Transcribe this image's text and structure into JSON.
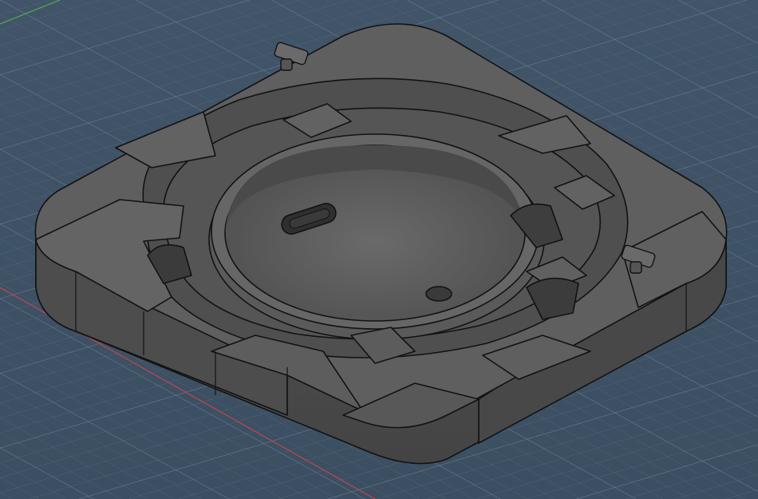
{
  "viewport": {
    "background_color": "#3f5265",
    "grid_minor_color": "#56697c",
    "grid_major_color": "#6c8094",
    "x_axis_color": "#c0464d",
    "y_axis_color": "#4fb055"
  },
  "model": {
    "body_color": "#5a5a5a",
    "top_face_color": "#5f5f5f",
    "side_face_color": "#4c4c4c",
    "edge_color": "#111111"
  }
}
